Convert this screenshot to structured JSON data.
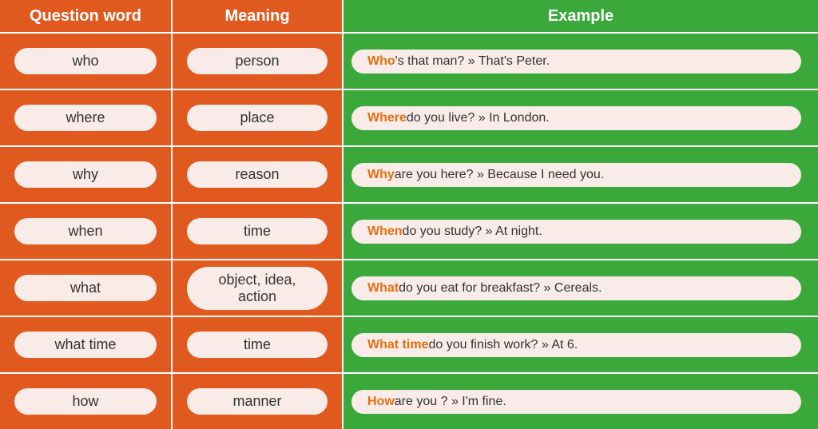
{
  "headers": {
    "question_word": "Question word",
    "meaning": "Meaning",
    "example": "Example"
  },
  "rows": [
    {
      "question": "who",
      "meaning": "person",
      "example_highlight": "Who",
      "example_rest": "'s that man? » That's Peter."
    },
    {
      "question": "where",
      "meaning": "place",
      "example_highlight": "Where",
      "example_rest": " do you live? » In London."
    },
    {
      "question": "why",
      "meaning": "reason",
      "example_highlight": "Why",
      "example_rest": " are you here? » Because I need you."
    },
    {
      "question": "when",
      "meaning": "time",
      "example_highlight": "When",
      "example_rest": " do you study? » At night."
    },
    {
      "question": "what",
      "meaning": "object, idea,\naction",
      "example_highlight": "What",
      "example_rest": " do you eat for breakfast? » Cereals."
    },
    {
      "question": "what time",
      "meaning": "time",
      "example_highlight": "What time",
      "example_rest": " do you finish work? » At 6."
    },
    {
      "question": "how",
      "meaning": "manner",
      "example_highlight": "How",
      "example_rest": " are you ? » I'm fine."
    }
  ]
}
